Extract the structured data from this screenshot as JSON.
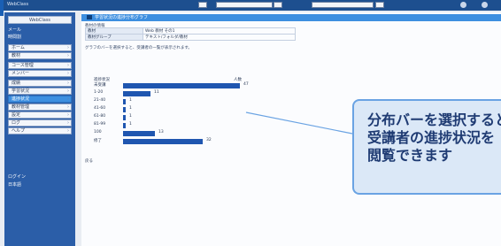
{
  "topbar": {
    "brand": "WebClass",
    "icon_a": "user-icon",
    "icon_b": "logout-icon"
  },
  "sidebar": {
    "logo": "WebClass",
    "head_items": [
      "メール",
      "時間割"
    ],
    "items": [
      "ホーム",
      "教材",
      "コース管理",
      "メンバー",
      "成績",
      "学習状況",
      "進捗状況",
      "教材管理",
      "設定",
      "ログ",
      "ヘルプ"
    ],
    "active_index": 6,
    "foot": [
      "ログイン",
      "日本語"
    ]
  },
  "main": {
    "title": "学習状況の進捗分布グラフ",
    "info_note": "教材の情報",
    "info_rows": [
      {
        "k": "教材",
        "v": "Web 教材 その1"
      },
      {
        "k": "教材グループ",
        "v": "テキスト/フォルダ/教材"
      }
    ],
    "desc": "グラフのバーを選択すると、受講者の一覧が表示されます。",
    "chart_head_left": "進捗状況",
    "chart_head_right": "人数",
    "footer_note": "戻る"
  },
  "chart_data": {
    "type": "bar",
    "orientation": "horizontal",
    "categories": [
      "未受講",
      "1-20",
      "21-40",
      "41-60",
      "61-80",
      "81-99",
      "100",
      "修了"
    ],
    "values": [
      47,
      11,
      1,
      1,
      1,
      1,
      13,
      32
    ],
    "xlim": [
      0,
      50
    ]
  },
  "callout": {
    "lines": [
      "分布バーを選択すると",
      "受講者の進捗状況を",
      "閲覧できます"
    ],
    "color": "#6aa3e3"
  }
}
